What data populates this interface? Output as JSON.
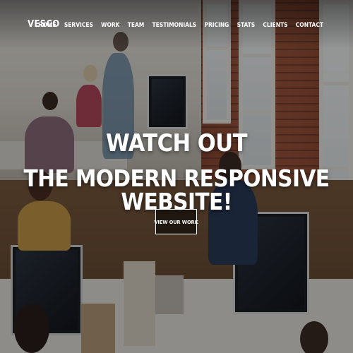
{
  "brand": "VESCO",
  "nav": {
    "items": [
      "HOME",
      "SERVICES",
      "WORK",
      "TEAM",
      "TESTIMONIALS",
      "PRICING",
      "STATS",
      "CLIENTS",
      "CONTACT"
    ]
  },
  "hero": {
    "title": "WATCH OUT",
    "subtitle": "THE MODERN RESPONSIVE WEBSITE!",
    "cta_label": "VIEW OUR WORK"
  }
}
